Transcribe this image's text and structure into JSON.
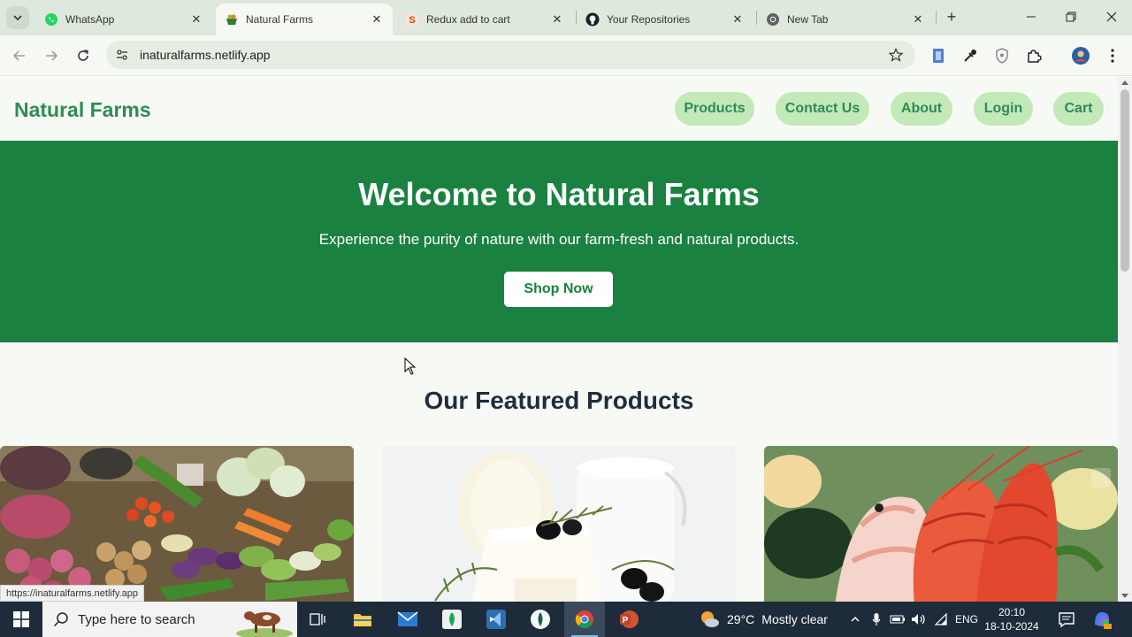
{
  "browser": {
    "tabs": [
      {
        "title": "WhatsApp",
        "icon": "whatsapp-icon"
      },
      {
        "title": "Natural Farms",
        "icon": "natural-farms-favicon",
        "active": true
      },
      {
        "title": "Redux add to cart",
        "icon": "stackblitz-icon"
      },
      {
        "title": "Your Repositories",
        "icon": "github-icon"
      },
      {
        "title": "New Tab",
        "icon": "chrome-icon"
      }
    ],
    "url": "inaturalfarms.netlify.app",
    "status_url": "https://inaturalfarms.netlify.app"
  },
  "site": {
    "brand": "Natural Farms",
    "nav": [
      "Products",
      "Contact Us",
      "About",
      "Login",
      "Cart"
    ],
    "hero": {
      "title": "Welcome to Natural Farms",
      "subtitle": "Experience the purity of nature with our farm-fresh and natural products.",
      "cta": "Shop Now"
    },
    "featured_title": "Our Featured Products",
    "products": [
      {
        "image": "vegetables-image"
      },
      {
        "image": "dairy-cheese-image"
      },
      {
        "image": "seafood-shrimp-image"
      }
    ],
    "colors": {
      "brand": "#2e8b57",
      "hero_bg": "#1a8140",
      "nav_pill": "#c3e9b8",
      "heading": "#1f2d3d"
    }
  },
  "taskbar": {
    "search_placeholder": "Type here to search",
    "weather_temp": "29°C",
    "weather_text": "Mostly clear",
    "language": "ENG",
    "time": "20:10",
    "date": "18-10-2024"
  }
}
